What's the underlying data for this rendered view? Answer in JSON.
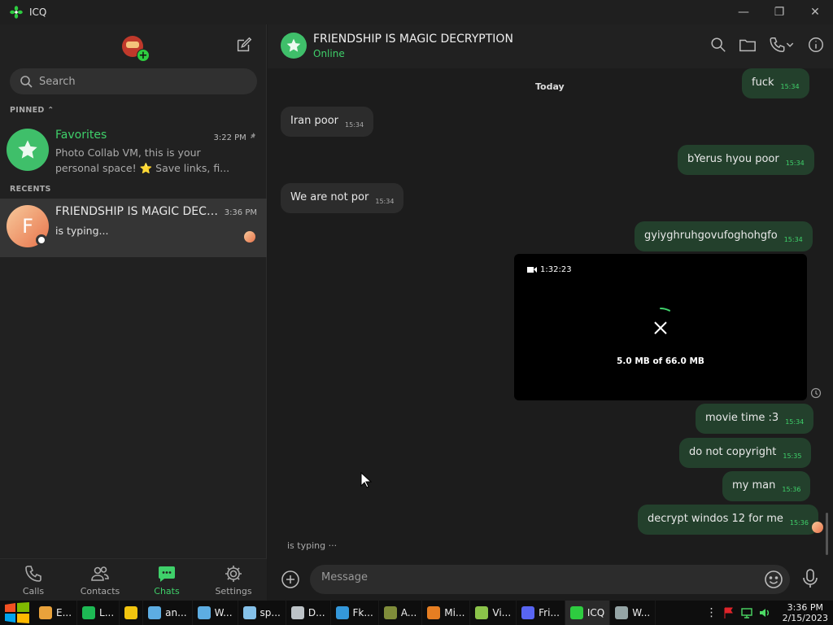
{
  "window": {
    "title": "ICQ",
    "minimize": "—",
    "restore": "❐",
    "close": "✕"
  },
  "sidebar": {
    "search_placeholder": "Search",
    "pinned_label": "PINNED",
    "recents_label": "RECENTS",
    "favorites": {
      "name": "Favorites",
      "time": "3:22 PM",
      "preview": "Photo Collab VM, this is your personal space! ⭐ Save links, fi..."
    },
    "friendship": {
      "initial": "F",
      "name": "FRIENDSHIP IS MAGIC DECRYPTION",
      "time": "3:36 PM",
      "preview": "is typing..."
    },
    "nav": [
      {
        "label": "Calls"
      },
      {
        "label": "Contacts"
      },
      {
        "label": "Chats"
      },
      {
        "label": "Settings"
      }
    ]
  },
  "chat": {
    "title": "FRIENDSHIP IS MAGIC DECRYPTION",
    "status": "Online",
    "date_separator": "Today",
    "messages": [
      {
        "text": "fuck",
        "time": "15:34"
      },
      {
        "text": "Iran poor",
        "time": "15:34"
      },
      {
        "text": "bYerus hyou poor",
        "time": "15:34"
      },
      {
        "text": "We are not por",
        "time": "15:34"
      },
      {
        "text": "gyiyghruhgovufoghohgfo",
        "time": "15:34"
      },
      {
        "text": "movie time :3",
        "time": "15:34"
      },
      {
        "text": "do not copyright",
        "time": "15:35"
      },
      {
        "text": "my man",
        "time": "15:36"
      },
      {
        "text": "decrypt windos 12 for me",
        "time": "15:36"
      }
    ],
    "video": {
      "duration": "1:32:23",
      "progress_text": "5.0 MB of 66.0 MB",
      "progress_fraction": 0.076
    },
    "typing": "is typing ···",
    "composer_placeholder": "Message"
  },
  "taskbar": {
    "apps": [
      {
        "label": "E...",
        "color": "#e9a23b"
      },
      {
        "label": "L...",
        "color": "#1db954"
      },
      {
        "label": "",
        "color": "#f1c40f"
      },
      {
        "label": "an...",
        "color": "#5dade2"
      },
      {
        "label": "W...",
        "color": "#5dade2"
      },
      {
        "label": "sp...",
        "color": "#85c1e9"
      },
      {
        "label": "D...",
        "color": "#bdc3c7"
      },
      {
        "label": "Fk...",
        "color": "#3498db"
      },
      {
        "label": "A...",
        "color": "#7f8c3a"
      },
      {
        "label": "Mi...",
        "color": "#e67e22"
      },
      {
        "label": "Vi...",
        "color": "#8bc34a"
      },
      {
        "label": "Fri...",
        "color": "#5865f2"
      },
      {
        "label": "ICQ",
        "color": "#2ecc40"
      },
      {
        "label": "W...",
        "color": "#95a5a6"
      }
    ],
    "time": "3:36 PM",
    "date": "2/15/2023"
  }
}
